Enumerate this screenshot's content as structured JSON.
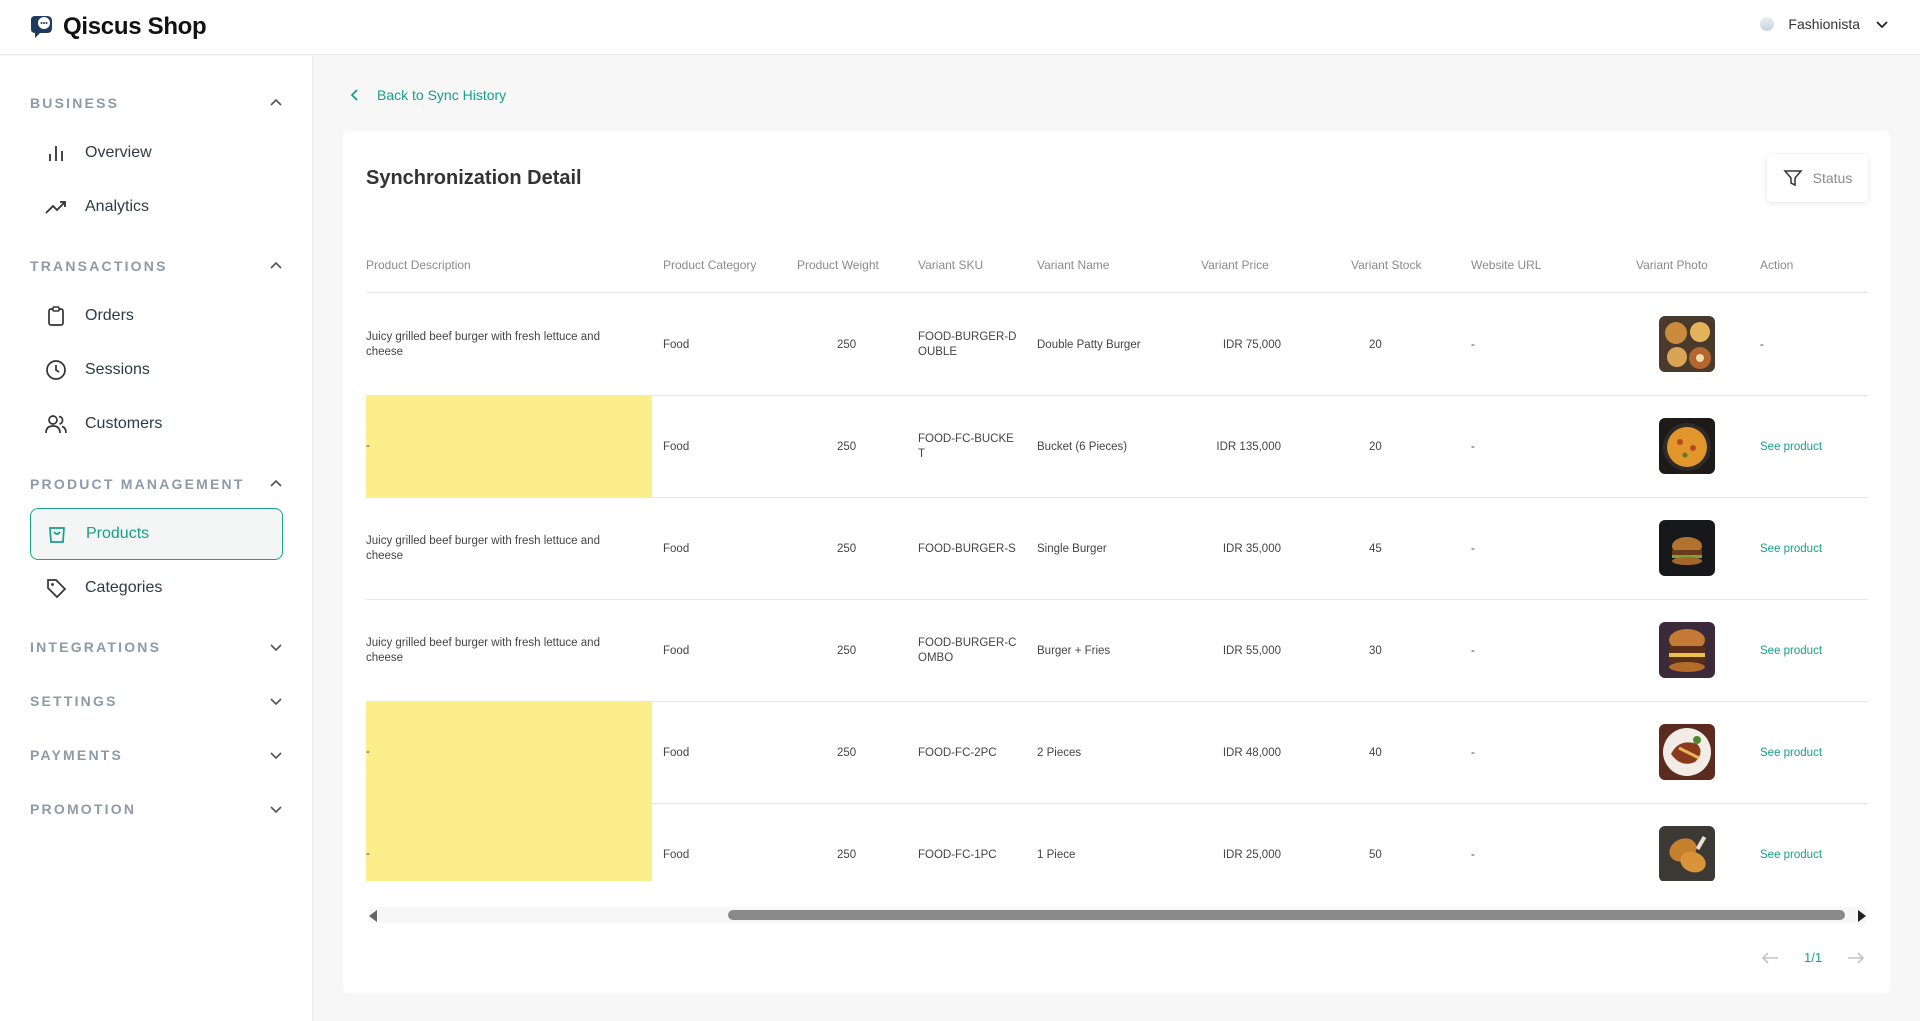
{
  "app": {
    "title": "Qiscus Shop"
  },
  "user": {
    "name": "Fashionista"
  },
  "sidebar": {
    "sections": [
      {
        "label": "BUSINESS",
        "expanded": true
      },
      {
        "label": "TRANSACTIONS",
        "expanded": true
      },
      {
        "label": "PRODUCT MANAGEMENT",
        "expanded": true
      },
      {
        "label": "INTEGRATIONS",
        "expanded": false
      },
      {
        "label": "SETTINGS",
        "expanded": false
      },
      {
        "label": "PAYMENTS",
        "expanded": false
      },
      {
        "label": "PROMOTION",
        "expanded": false
      }
    ],
    "items": {
      "overview": "Overview",
      "analytics": "Analytics",
      "orders": "Orders",
      "sessions": "Sessions",
      "customers": "Customers",
      "products": "Products",
      "categories": "Categories"
    }
  },
  "main": {
    "back_label": "Back to Sync History",
    "title": "Synchronization Detail",
    "status_label": "Status",
    "accent_color": "#17a088",
    "highlight_color": "#fdee8c",
    "columns": [
      "Product Description",
      "Product Category",
      "Product Weight",
      "Variant SKU",
      "Variant Name",
      "Variant Price",
      "Variant Stock",
      "Website URL",
      "Variant Photo",
      "Action"
    ],
    "rows": [
      {
        "desc": "Juicy grilled beef burger with fresh lettuce and cheese",
        "category": "Food",
        "weight": "250",
        "sku": "FOOD-BURGER-DOUBLE",
        "name": "Double Patty Burger",
        "price": "IDR 75,000",
        "stock": "20",
        "url": "-",
        "photo": "food-platter",
        "action": "-"
      },
      {
        "desc": "-",
        "category": "Food",
        "weight": "250",
        "sku": "FOOD-FC-BUCKET",
        "name": "Bucket (6 Pieces)",
        "price": "IDR 135,000",
        "stock": "20",
        "url": "-",
        "photo": "paella-pan",
        "action": "See product"
      },
      {
        "desc": "Juicy grilled beef burger with fresh lettuce and cheese",
        "category": "Food",
        "weight": "250",
        "sku": "FOOD-BURGER-S",
        "name": "Single Burger",
        "price": "IDR 35,000",
        "stock": "45",
        "url": "-",
        "photo": "burger-dark",
        "action": "See product"
      },
      {
        "desc": "Juicy grilled beef burger with fresh lettuce and cheese",
        "category": "Food",
        "weight": "250",
        "sku": "FOOD-BURGER-COMBO",
        "name": "Burger + Fries",
        "price": "IDR 55,000",
        "stock": "30",
        "url": "-",
        "photo": "burger-combo",
        "action": "See product"
      },
      {
        "desc": "-",
        "category": "Food",
        "weight": "250",
        "sku": "FOOD-FC-2PC",
        "name": "2 Pieces",
        "price": "IDR 48,000",
        "stock": "40",
        "url": "-",
        "photo": "steak-plate",
        "action": "See product"
      },
      {
        "desc": "-",
        "category": "Food",
        "weight": "250",
        "sku": "FOOD-FC-1PC",
        "name": "1 Piece",
        "price": "IDR 25,000",
        "stock": "50",
        "url": "-",
        "photo": "fried-chicken",
        "action": "See product"
      }
    ],
    "pagination": {
      "label": "1/1"
    }
  }
}
